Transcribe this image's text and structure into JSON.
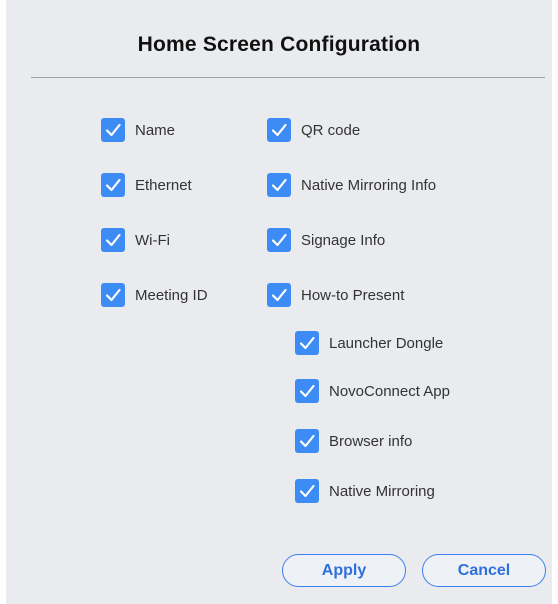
{
  "dialog": {
    "title": "Home Screen Configuration"
  },
  "options": {
    "name": {
      "label": "Name",
      "checked": true
    },
    "ethernet": {
      "label": "Ethernet",
      "checked": true
    },
    "wifi": {
      "label": "Wi-Fi",
      "checked": true
    },
    "meeting_id": {
      "label": "Meeting ID",
      "checked": true
    },
    "qr_code": {
      "label": "QR code",
      "checked": true
    },
    "native_mirroring_info": {
      "label": "Native Mirroring Info",
      "checked": true
    },
    "signage_info": {
      "label": "Signage Info",
      "checked": true
    },
    "how_to_present": {
      "label": "How-to Present",
      "checked": true
    },
    "launcher_dongle": {
      "label": "Launcher Dongle",
      "checked": true
    },
    "novoconnect_app": {
      "label": "NovoConnect App",
      "checked": true
    },
    "browser_info": {
      "label": "Browser info",
      "checked": true
    },
    "native_mirroring": {
      "label": "Native Mirroring",
      "checked": true
    }
  },
  "buttons": {
    "apply": "Apply",
    "cancel": "Cancel"
  },
  "colors": {
    "checkbox": "#3d8cf5",
    "button_accent": "#2f6fdc",
    "background": "#e9ebee"
  },
  "icons": {
    "checkbox": "checkmark-icon"
  }
}
